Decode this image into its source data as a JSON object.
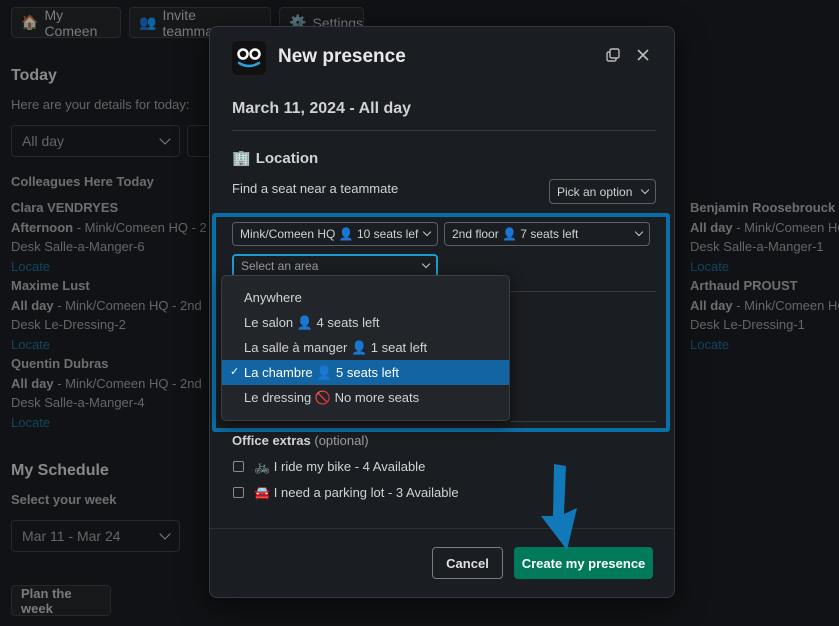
{
  "top_buttons": [
    {
      "icon": "house-icon",
      "label": "My Comeen"
    },
    {
      "icon": "people-icon",
      "label": "Invite teammates"
    },
    {
      "icon": "gear-icon",
      "label": "Settings"
    }
  ],
  "today": {
    "title": "Today",
    "subtitle": "Here are your details for today:",
    "period_select": "All day",
    "colleagues_title": "Colleagues Here Today"
  },
  "colleagues_left": [
    {
      "name": "Clara VENDRYES",
      "period": "Afternoon",
      "location": " - Mink/Comeen HQ - 2",
      "desk": "Desk Salle-a-Manger-6",
      "action": "Locate"
    },
    {
      "name": "Maxime Lust",
      "period": "All day",
      "location": " - Mink/Comeen HQ - 2nd",
      "desk": "Desk Le-Dressing-2",
      "action": "Locate"
    },
    {
      "name": "Quentin Dubras",
      "period": "All day",
      "location": " - Mink/Comeen HQ - 2nd",
      "desk": "Desk Salle-a-Manger-4",
      "action": "Locate"
    }
  ],
  "colleagues_right": [
    {
      "name": "Benjamin Roosebrouck",
      "period": "All day",
      "location": " - Mink/Comeen HQ",
      "desk": "Desk Salle-a-Manger-1",
      "action": "Locate"
    },
    {
      "name": "Arthaud PROUST",
      "period": "All day",
      "location": " - Mink/Comeen HQ",
      "desk": "Desk Le-Dressing-1",
      "action": "Locate"
    }
  ],
  "schedule": {
    "title": "My Schedule",
    "subtitle": "Select your week",
    "week_select": "Mar 11 - Mar 24",
    "plan_button": "Plan the week"
  },
  "modal": {
    "title": "New presence",
    "date": "March 11, 2024 - All day",
    "location_title": "Location",
    "find_seat": "Find a seat near a teammate",
    "pick_option": "Pick an option",
    "site_select": "Mink/Comeen HQ 👤 10 seats lef",
    "floor_select": "2nd floor 👤 7 seats left",
    "area_placeholder": "Select an area",
    "area_options": [
      {
        "label": "Anywhere",
        "selected": false
      },
      {
        "label": "Le salon 👤 4 seats left",
        "selected": false
      },
      {
        "label": "La salle à manger 👤 1 seat left",
        "selected": false
      },
      {
        "label": "La chambre 👤 5 seats left",
        "selected": true
      },
      {
        "label": "Le dressing 🚫 No more seats",
        "selected": false
      }
    ],
    "check_mark": "✓",
    "extras_title": "Office extras",
    "extras_optional": " (optional)",
    "extras": [
      {
        "label": "🚲 I ride my bike - 4 Available",
        "checked": false
      },
      {
        "label": "🚘 I need a parking lot - 3 Available",
        "checked": false
      }
    ],
    "cancel_label": "Cancel",
    "create_label": "Create my presence"
  },
  "colors": {
    "accent_blue": "#0b6fa7",
    "primary_green": "#007a5a",
    "selected_option": "#1264a3",
    "arrow": "#1178b9"
  }
}
